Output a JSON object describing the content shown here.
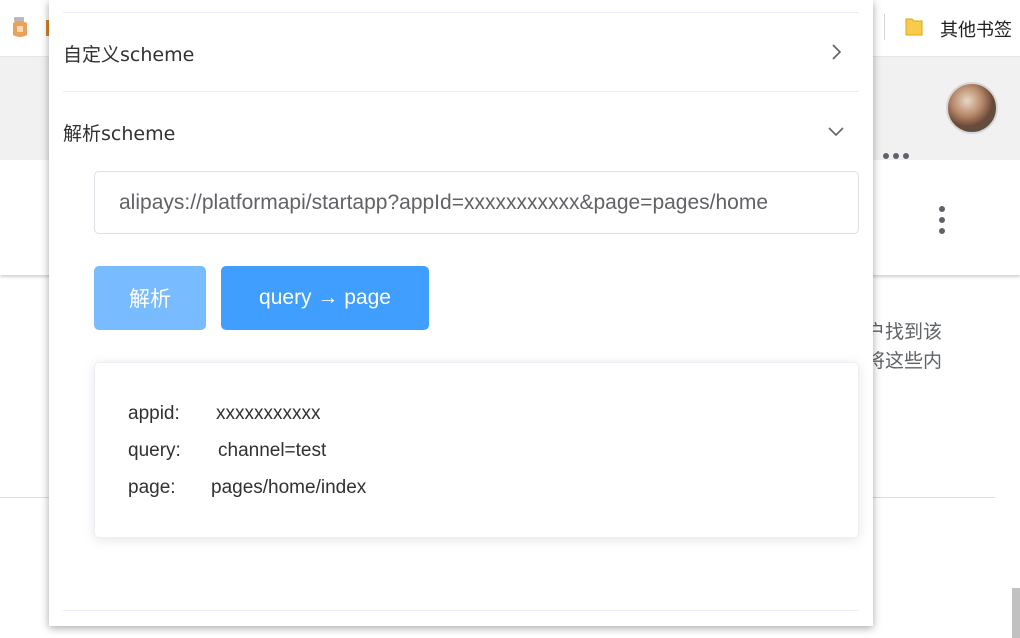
{
  "browser": {
    "bookmark_folder_label": "其他书签",
    "bg_text_line1": "户找到该",
    "bg_text_line2": "将这些内"
  },
  "popup": {
    "sections": [
      {
        "title": "自定义scheme",
        "expanded": false
      },
      {
        "title": "解析scheme",
        "expanded": true
      }
    ],
    "scheme_input_value": "alipays://platformapi/startapp?appId=xxxxxxxxxxx&page=pages/home",
    "buttons": {
      "parse_label": "解析",
      "query_to_page_label": "query → page"
    },
    "result": {
      "appid_label": "appid:",
      "appid_value": "xxxxxxxxxxx",
      "query_label": "query:",
      "query_value": "channel=test",
      "page_label": "page:",
      "page_value": "pages/home/index"
    }
  },
  "colors": {
    "primary": "#409eff",
    "primary_light": "#79bbff",
    "border": "#dcdfe6"
  },
  "icons": [
    "extension-icon",
    "folder-icon",
    "apps-grid-icon",
    "avatar",
    "more-vert-icon",
    "chevron-right-icon",
    "chevron-down-icon"
  ]
}
